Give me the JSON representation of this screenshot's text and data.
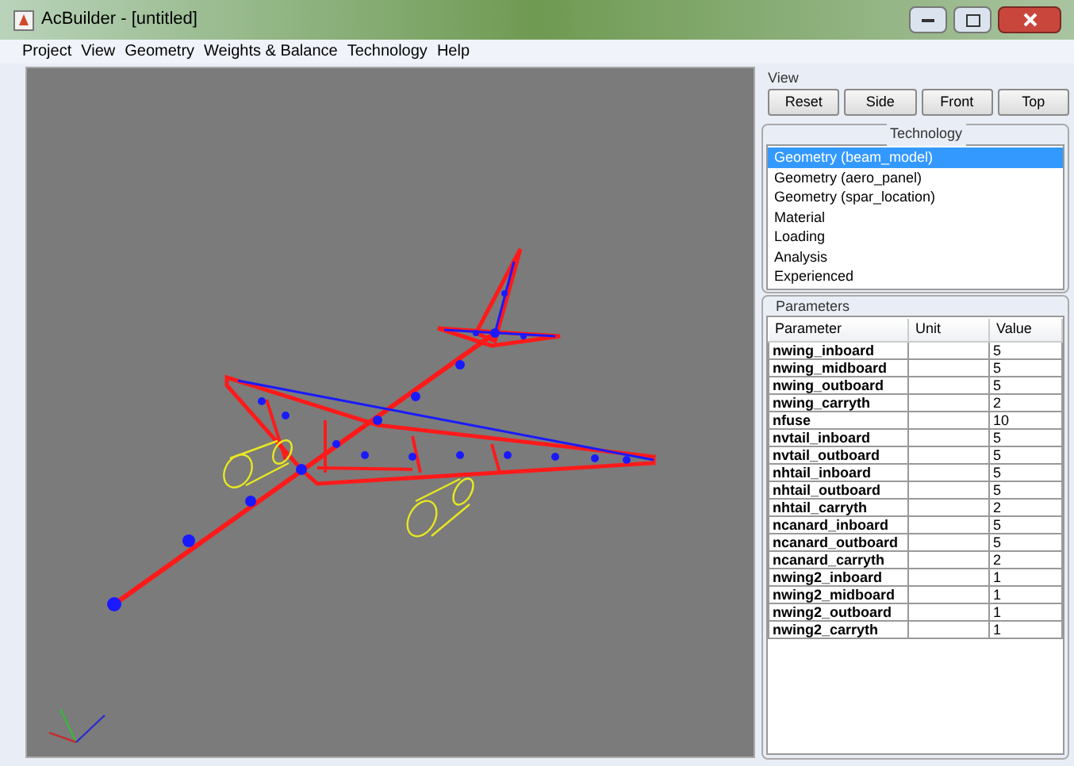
{
  "window": {
    "title": "AcBuilder - [untitled]"
  },
  "menu": [
    "Project",
    "View",
    "Geometry",
    "Weights & Balance",
    "Technology",
    "Help"
  ],
  "view": {
    "label": "View",
    "buttons": [
      "Reset",
      "Side",
      "Front",
      "Top"
    ]
  },
  "technology": {
    "title": "Technology",
    "items": [
      {
        "label": "Geometry (beam_model)",
        "selected": true
      },
      {
        "label": "Geometry (aero_panel)",
        "selected": false
      },
      {
        "label": "Geometry (spar_location)",
        "selected": false
      },
      {
        "label": "Material",
        "selected": false
      },
      {
        "label": "Loading",
        "selected": false
      },
      {
        "label": "Analysis",
        "selected": false
      },
      {
        "label": "Experienced",
        "selected": false
      }
    ]
  },
  "parameters": {
    "title": "Parameters",
    "columns": [
      "Parameter",
      "Unit",
      "Value"
    ],
    "rows": [
      {
        "parameter": "nwing_inboard",
        "value": "5"
      },
      {
        "parameter": "nwing_midboard",
        "value": "5"
      },
      {
        "parameter": "nwing_outboard",
        "value": "5"
      },
      {
        "parameter": "nwing_carryth",
        "value": "2"
      },
      {
        "parameter": "nfuse",
        "value": "10"
      },
      {
        "parameter": "nvtail_inboard",
        "value": "5"
      },
      {
        "parameter": "nvtail_outboard",
        "value": "5"
      },
      {
        "parameter": "nhtail_inboard",
        "value": "5"
      },
      {
        "parameter": "nhtail_outboard",
        "value": "5"
      },
      {
        "parameter": "nhtail_carryth",
        "value": "2"
      },
      {
        "parameter": "ncanard_inboard",
        "value": "5"
      },
      {
        "parameter": "ncanard_outboard",
        "value": "5"
      },
      {
        "parameter": "ncanard_carryth",
        "value": "2"
      },
      {
        "parameter": "nwing2_inboard",
        "value": "1"
      },
      {
        "parameter": "nwing2_midboard",
        "value": "1"
      },
      {
        "parameter": "nwing2_outboard",
        "value": "1"
      },
      {
        "parameter": "nwing2_carryth",
        "value": "1"
      }
    ]
  }
}
